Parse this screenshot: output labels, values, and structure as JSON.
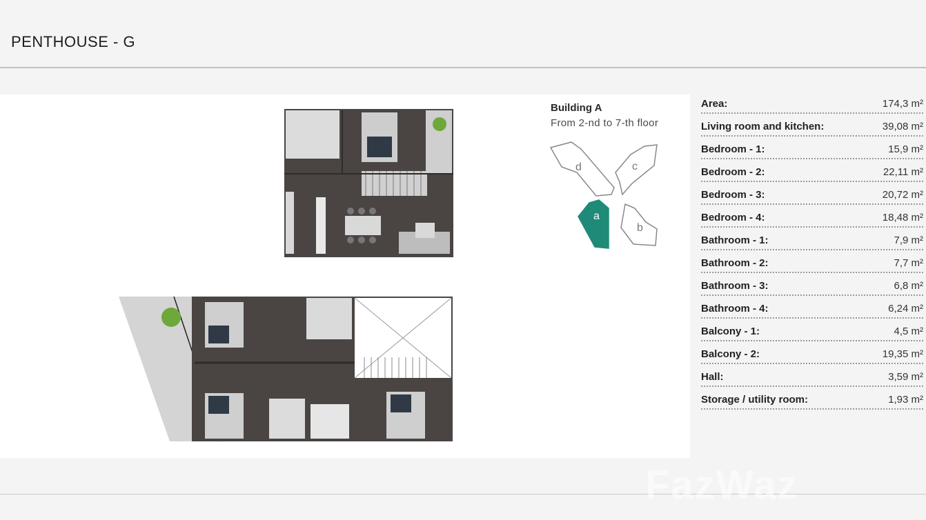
{
  "page": {
    "title": "PENTHOUSE - G"
  },
  "building": {
    "name": "Building A",
    "floors": "From 2-nd to 7-th floor"
  },
  "keyplan": {
    "sections": [
      "d",
      "c",
      "a",
      "b"
    ],
    "selected": "a",
    "accent": "#1f8a78"
  },
  "specs": [
    {
      "label": "Area:",
      "value": "174,3 m²"
    },
    {
      "label": "Living room and kitchen:",
      "value": "39,08 m²"
    },
    {
      "label": "Bedroom - 1:",
      "value": "15,9 m²"
    },
    {
      "label": "Bedroom - 2:",
      "value": "22,11 m²"
    },
    {
      "label": "Bedroom - 3:",
      "value": "20,72 m²"
    },
    {
      "label": "Bedroom - 4:",
      "value": "18,48 m²"
    },
    {
      "label": "Bathroom - 1:",
      "value": "7,9 m²"
    },
    {
      "label": "Bathroom - 2:",
      "value": "7,7 m²"
    },
    {
      "label": "Bathroom - 3:",
      "value": "6,8 m²"
    },
    {
      "label": "Bathroom - 4:",
      "value": "6,24 m²"
    },
    {
      "label": "Balcony - 1:",
      "value": "4,5 m²"
    },
    {
      "label": "Balcony - 2:",
      "value": "19,35 m²"
    },
    {
      "label": "Hall:",
      "value": "3,59 m²"
    },
    {
      "label": "Storage / utility room:",
      "value": "1,93 m²"
    }
  ],
  "watermark": "FazWaz"
}
